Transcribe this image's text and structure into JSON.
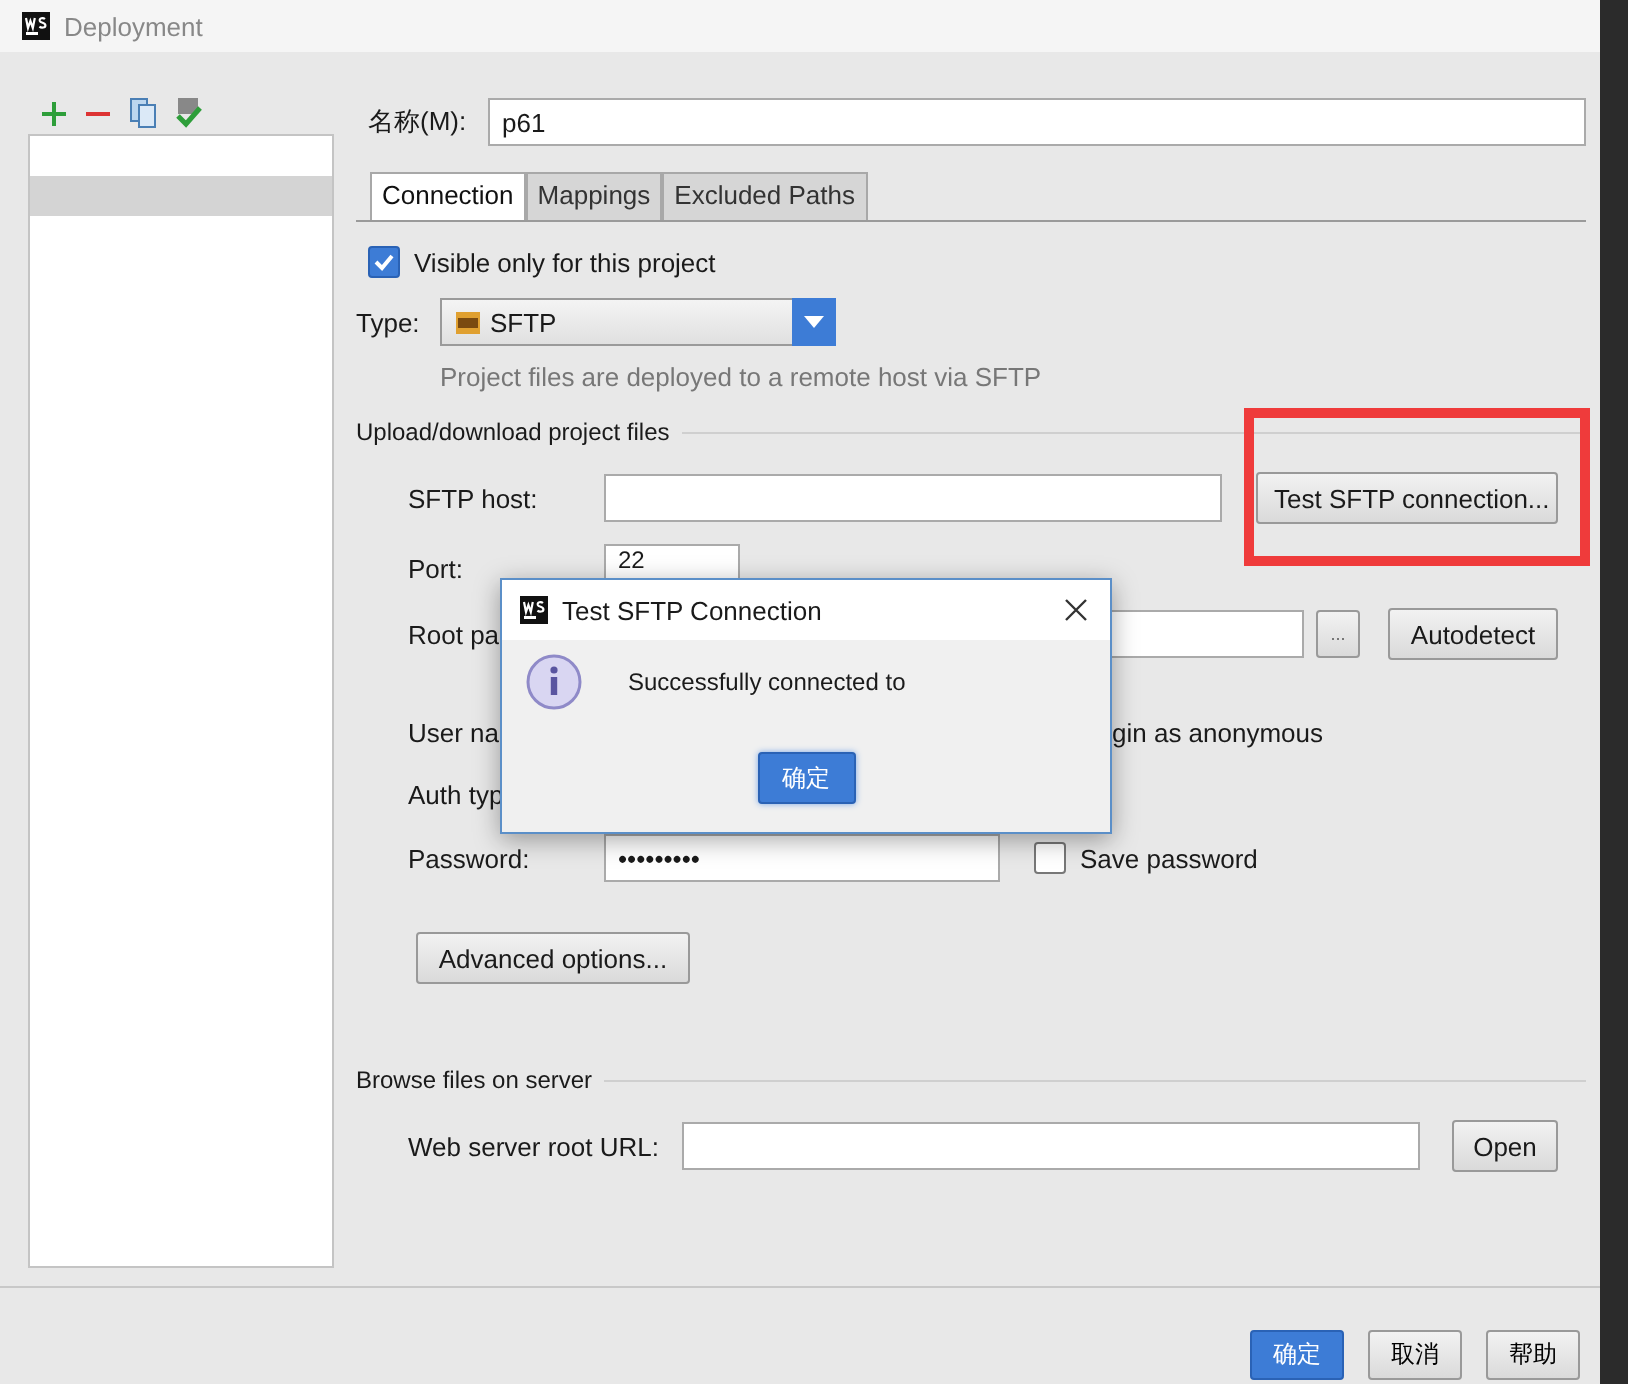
{
  "window": {
    "title": "Deployment"
  },
  "name_field": {
    "label": "名称(M):",
    "value": "p61"
  },
  "tabs": [
    {
      "label": "Connection",
      "selected": true
    },
    {
      "label": "Mappings",
      "selected": false
    },
    {
      "label": "Excluded Paths",
      "selected": false
    }
  ],
  "visible_only": {
    "label": "Visible only for this project",
    "checked": true
  },
  "type": {
    "label": "Type:",
    "value": "SFTP",
    "hint": "Project files are deployed to a remote host via SFTP"
  },
  "upload_section": {
    "title": "Upload/download project files"
  },
  "sftp_host": {
    "label": "SFTP host:",
    "button": "Test SFTP connection..."
  },
  "port": {
    "label": "Port:",
    "value": "22"
  },
  "root_path": {
    "label": "Root pa",
    "browse": "...",
    "button": "Autodetect"
  },
  "user_name": {
    "label": "User na",
    "anonymous": "gin as anonymous"
  },
  "auth_type": {
    "label": "Auth typ"
  },
  "password": {
    "label": "Password:",
    "value": "•••••••••",
    "save": {
      "label": "Save password",
      "checked": false
    }
  },
  "advanced": "Advanced options...",
  "browse_section": {
    "title": "Browse files on server",
    "url_label": "Web server root URL:",
    "button": "Open"
  },
  "buttons": [
    {
      "label": "确定",
      "primary": true
    },
    {
      "label": "取消",
      "primary": false
    },
    {
      "label": "帮助",
      "primary": false
    }
  ],
  "modal": {
    "title": "Test SFTP Connection",
    "message": "Successfully connected to",
    "button": "确定"
  }
}
